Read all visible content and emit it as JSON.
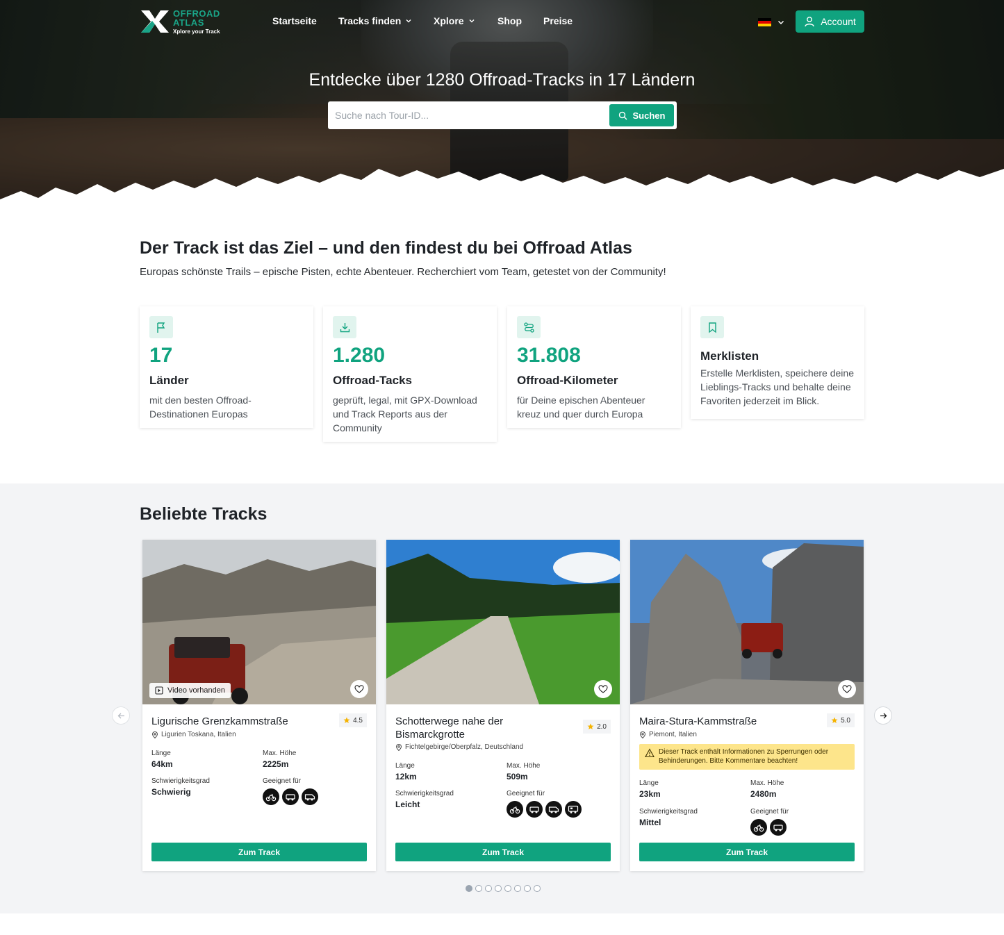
{
  "brand": {
    "line1": "OFFROAD",
    "line2": "ATLAS",
    "tagline": "Xplore your Track"
  },
  "nav": {
    "items": [
      "Startseite",
      "Tracks finden",
      "Xplore",
      "Shop",
      "Preise"
    ],
    "account_label": "Account",
    "language": "de"
  },
  "hero": {
    "headline": "Entdecke über 1280 Offroad-Tracks in 17 Ländern",
    "search_placeholder": "Suche nach Tour-ID...",
    "search_button": "Suchen"
  },
  "intro": {
    "title": "Der Track ist das Ziel – und den findest du bei Offroad Atlas",
    "subtitle": "Europas schönste Trails – epische Pisten, echte Abenteuer. Recherchiert vom Team, getestet von der Community!"
  },
  "stats": [
    {
      "icon": "flag-icon",
      "number": "17",
      "title": "Länder",
      "desc": "mit den besten Offroad-Destinationen Europas"
    },
    {
      "icon": "download-icon",
      "number": "1.280",
      "title": "Offroad-Tacks",
      "desc": "geprüft, legal, mit GPX-Download und Track Reports aus der Community"
    },
    {
      "icon": "route-icon",
      "number": "31.808",
      "title": "Offroad-Kilometer",
      "desc": "für Deine epischen Abenteuer kreuz und quer durch Europa"
    },
    {
      "icon": "bookmark-icon",
      "number": "",
      "title": "Merklisten",
      "desc": "Erstelle Merklisten, speichere deine Lieblings-Tracks und behalte deine Favoriten jederzeit im Blick."
    }
  ],
  "popular": {
    "title": "Beliebte Tracks",
    "labels": {
      "length": "Länge",
      "max_height": "Max. Höhe",
      "difficulty": "Schwierigkeitsgrad",
      "suitable": "Geeignet für",
      "button": "Zum Track",
      "video": "Video vorhanden"
    },
    "tracks": [
      {
        "title": "Ligurische Grenzkammstraße",
        "rating": "4.5",
        "location": "Ligurien Toskana, Italien",
        "length": "64km",
        "max_height": "2225m",
        "difficulty": "Schwierig",
        "video": true,
        "vehicles": [
          "motorbike",
          "suv",
          "van"
        ]
      },
      {
        "title": "Schotterwege nahe der Bismarckgrotte",
        "rating": "2.0",
        "location": "Fichtelgebirge/Oberpfalz, Deutschland",
        "length": "12km",
        "max_height": "509m",
        "difficulty": "Leicht",
        "video": false,
        "vehicles": [
          "motorbike",
          "suv",
          "van",
          "camper"
        ]
      },
      {
        "title": "Maira-Stura-Kammstraße",
        "rating": "5.0",
        "location": "Piemont, Italien",
        "length": "23km",
        "max_height": "2480m",
        "difficulty": "Mittel",
        "video": false,
        "warning": "Dieser Track enthält Informationen zu Sperrungen oder Behinderungen. Bitte Kommentare beachten!",
        "vehicles": [
          "motorbike",
          "suv"
        ]
      }
    ],
    "pages": 8,
    "active_page": 1
  },
  "colors": {
    "accent": "#10a37f",
    "accent_light": "#e1f4ee",
    "section_bg": "#f3f4f6",
    "warning": "#fde58b"
  }
}
